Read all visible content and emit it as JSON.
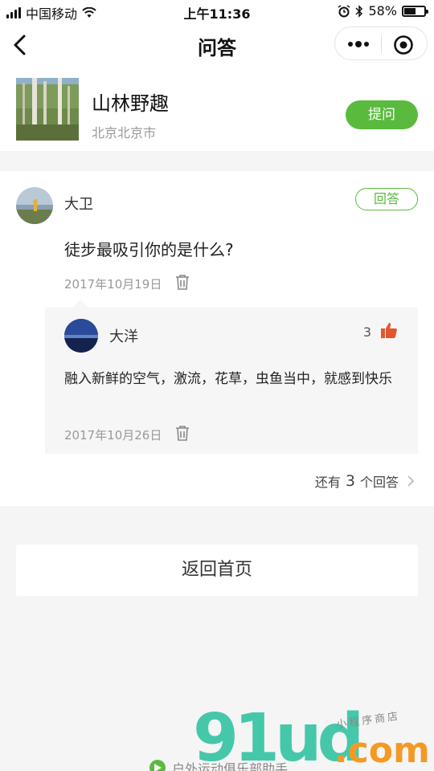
{
  "status_bar": {
    "carrier": "中国移动",
    "time": "上午11:36",
    "battery": "58%",
    "battery_level": 0.58
  },
  "nav": {
    "title": "问答",
    "back_icon": "chevron-left-icon",
    "more_icon": "more-dots-icon",
    "close_icon": "target-circle-icon"
  },
  "place": {
    "title": "山林野趣",
    "location": "北京北京市",
    "ask_label": "提问"
  },
  "question": {
    "user": "大卫",
    "reply_label": "回答",
    "text": "徒步最吸引你的是什么?",
    "date": "2017年10月19日"
  },
  "answer": {
    "user": "大洋",
    "likes": "3",
    "text": "融入新鲜的空气，激流，花草，虫鱼当中，就感到快乐",
    "date": "2017年10月26日"
  },
  "more_answers": {
    "prefix": "还有",
    "count": "3",
    "suffix": "个回答"
  },
  "home_button": "返回首页",
  "footer_text": "户外运动俱乐部助手",
  "watermark": {
    "logo": "91ud",
    "com": ".com",
    "cn": "小程序商店"
  },
  "colors": {
    "accent": "#5aba3e",
    "like": "#e3562e",
    "background": "#f5f5f5"
  }
}
